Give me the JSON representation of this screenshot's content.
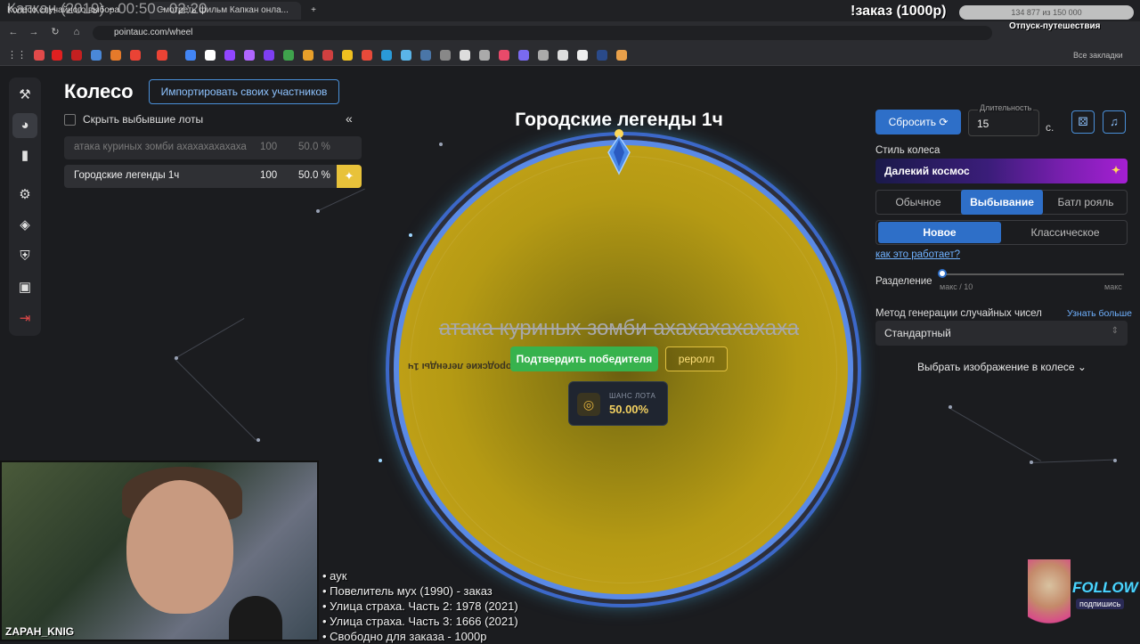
{
  "stream": {
    "title": "Капкан (2019) - 00:50 - 02:20",
    "order_label": "!заказ (1000р)",
    "goal_progress": "134 877 из 150 000",
    "goal_name": "Отпуск-путешествия",
    "streamer_name": "ZAPAH_KNIG",
    "follow_label": "FOLLOW",
    "follow_sub": "подпишись",
    "order_list": [
      "• аук",
      "• Повелитель мух (1990) - заказ",
      "• Улица страха. Часть 2: 1978 (2021)",
      "• Улица страха. Часть 3: 1666 (2021)",
      "• Свободно для заказа - 1000р"
    ]
  },
  "browser": {
    "tabs": [
      {
        "title": "Колесо случайного выбора"
      },
      {
        "title": "Смотреть фильм Капкан онла..."
      }
    ],
    "url": "pointauc.com/wheel",
    "bookmarks_label": "Все закладки"
  },
  "app": {
    "title": "Колесо",
    "import_button": "Импортировать своих участников",
    "hide_dropped_label": "Скрыть выбывшие лоты",
    "collapse_icon": "«",
    "lots": [
      {
        "name": "атака куриных зомби ахахахахахаха",
        "amount": "100",
        "percent": "50.0 %",
        "dropped": true
      },
      {
        "name": "Городские легенды 1ч",
        "amount": "100",
        "percent": "50.0 %",
        "dropped": false
      }
    ],
    "wheel_title": "Городские легенды 1ч",
    "winner_text": "атака куриных зомби ахахахахахаха",
    "sector_label": "Городские легенды 1ч",
    "confirm_button": "Подтвердить победителя",
    "reroll_button": "реролл",
    "chance_label": "ШАНС ЛОТА",
    "chance_value": "50.00%"
  },
  "settings": {
    "reset_button": "Сбросить",
    "duration_label": "Длительность",
    "duration_value": "15",
    "duration_unit": "с.",
    "style_label": "Стиль колеса",
    "style_value": "Далекий космос",
    "mode_options": [
      "Обычное",
      "Выбывание",
      "Батл рояль"
    ],
    "mode_selected": "Выбывание",
    "variant_options": [
      "Новое",
      "Классическое"
    ],
    "variant_selected": "Новое",
    "how_it_works": "как это работает?",
    "split_label": "Разделение",
    "split_min": "макс / 10",
    "split_max": "макс",
    "split_value": 0,
    "rng_label": "Метод генерации случайных чисел",
    "rng_more": "Узнать больше",
    "rng_value": "Стандартный",
    "image_select": "Выбрать изображение в колесе"
  },
  "colors": {
    "accent": "#2e6fc8",
    "wheel_fill": "#c6a418",
    "confirm": "#37b24d",
    "style_gradient_end": "#a51fd3"
  }
}
